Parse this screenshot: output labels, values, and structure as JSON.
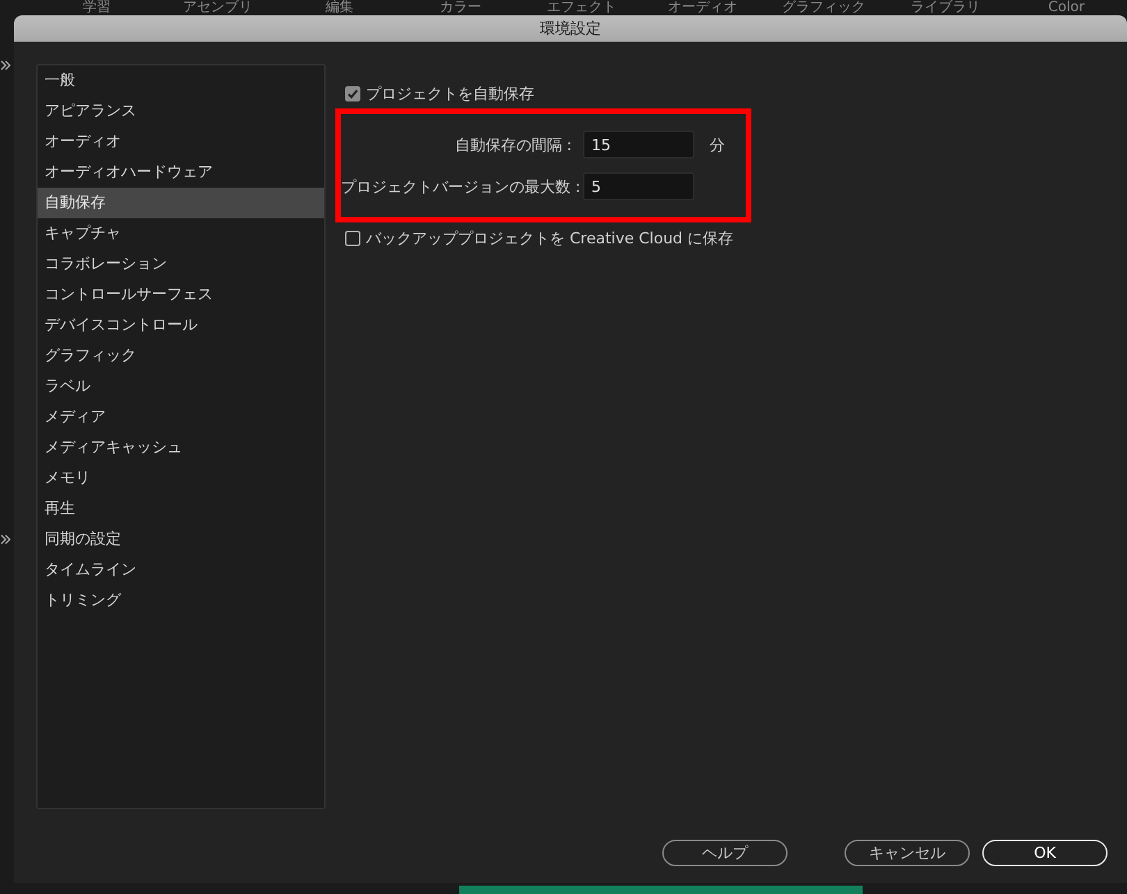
{
  "workspace_tabs": [
    "学習",
    "アセンブリ",
    "編集",
    "カラー",
    "エフェクト",
    "オーディオ",
    "グラフィック",
    "ライブラリ",
    "Color"
  ],
  "window": {
    "title": "環境設定"
  },
  "sidebar": {
    "items": [
      {
        "label": "一般",
        "selected": false
      },
      {
        "label": "アピアランス",
        "selected": false
      },
      {
        "label": "オーディオ",
        "selected": false
      },
      {
        "label": "オーディオハードウェア",
        "selected": false
      },
      {
        "label": "自動保存",
        "selected": true
      },
      {
        "label": "キャプチャ",
        "selected": false
      },
      {
        "label": "コラボレーション",
        "selected": false
      },
      {
        "label": "コントロールサーフェス",
        "selected": false
      },
      {
        "label": "デバイスコントロール",
        "selected": false
      },
      {
        "label": "グラフィック",
        "selected": false
      },
      {
        "label": "ラベル",
        "selected": false
      },
      {
        "label": "メディア",
        "selected": false
      },
      {
        "label": "メディアキャッシュ",
        "selected": false
      },
      {
        "label": "メモリ",
        "selected": false
      },
      {
        "label": "再生",
        "selected": false
      },
      {
        "label": "同期の設定",
        "selected": false
      },
      {
        "label": "タイムライン",
        "selected": false
      },
      {
        "label": "トリミング",
        "selected": false
      }
    ]
  },
  "options": [
    {
      "kind": "checkbox",
      "label": "プロジェクトを自動保存",
      "checked": true
    },
    {
      "kind": "group",
      "highlighted": true,
      "fields": [
        {
          "label": "自動保存の間隔 :",
          "value": "15",
          "unit": "分"
        },
        {
          "label": "プロジェクトバージョンの最大数 :",
          "value": "5"
        }
      ]
    },
    {
      "kind": "checkbox",
      "label": "バックアッププロジェクトを Creative Cloud に保存",
      "checked": false
    }
  ],
  "buttons": [
    {
      "label": "ヘルプ",
      "kind": "secondary"
    },
    {
      "label": "キャンセル",
      "kind": "secondary"
    },
    {
      "label": "OK",
      "kind": "primary"
    }
  ]
}
